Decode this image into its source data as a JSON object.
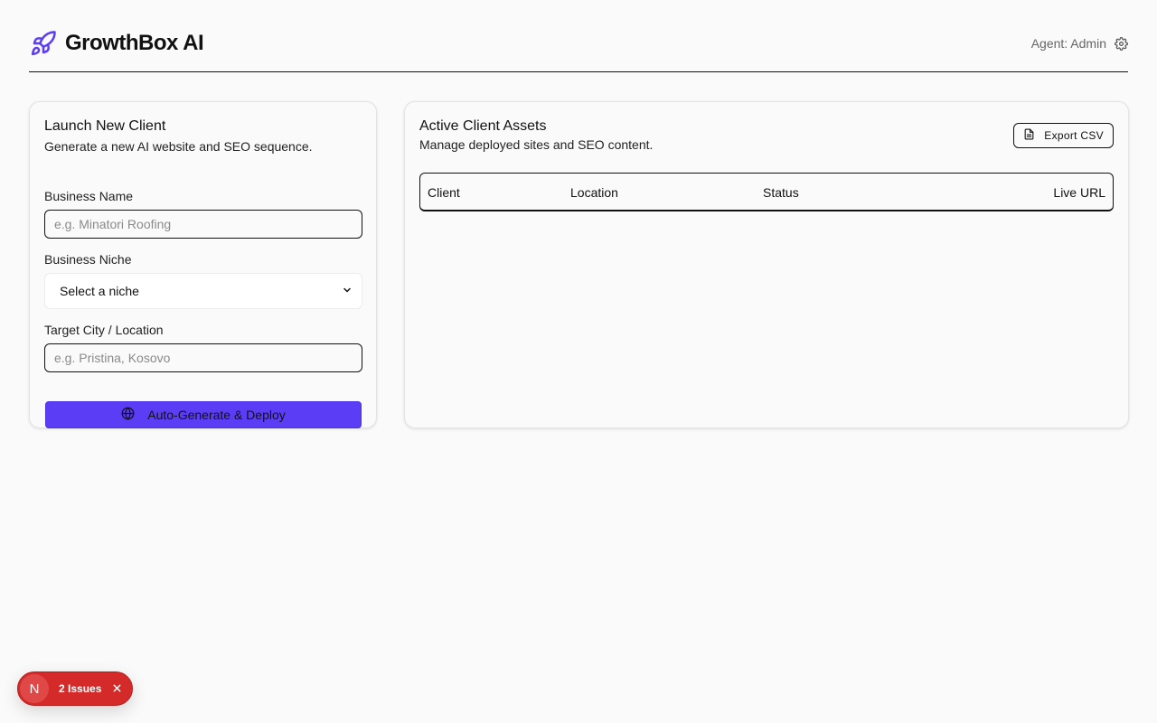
{
  "header": {
    "brand_icon": "rocket-icon",
    "title": "GrowthBox AI",
    "agent_label": "Agent: Admin",
    "settings_icon": "gear-icon"
  },
  "launch_form": {
    "title": "Launch New Client",
    "description": "Generate a new AI website and SEO sequence.",
    "business_name_label": "Business Name",
    "business_name_placeholder": "e.g. Minatori Roofing",
    "business_name_value": "",
    "niche_label": "Business Niche",
    "niche_selected": "Select a niche",
    "city_label": "Target City / Location",
    "city_placeholder": "e.g. Pristina, Kosovo",
    "city_value": "",
    "deploy_button": "Auto-Generate & Deploy",
    "deploy_icon": "globe-icon"
  },
  "assets": {
    "title": "Active Client Assets",
    "description": "Manage deployed sites and SEO content.",
    "export_button": "Export CSV",
    "export_icon": "file-text-icon",
    "columns": [
      "Client",
      "Location",
      "Status",
      "Live URL"
    ],
    "rows": []
  },
  "issues_badge": {
    "avatar_letter": "N",
    "label": "2 Issues"
  },
  "colors": {
    "accent": "#5b3df5",
    "danger": "#d42a2a",
    "background": "#fafafa"
  }
}
